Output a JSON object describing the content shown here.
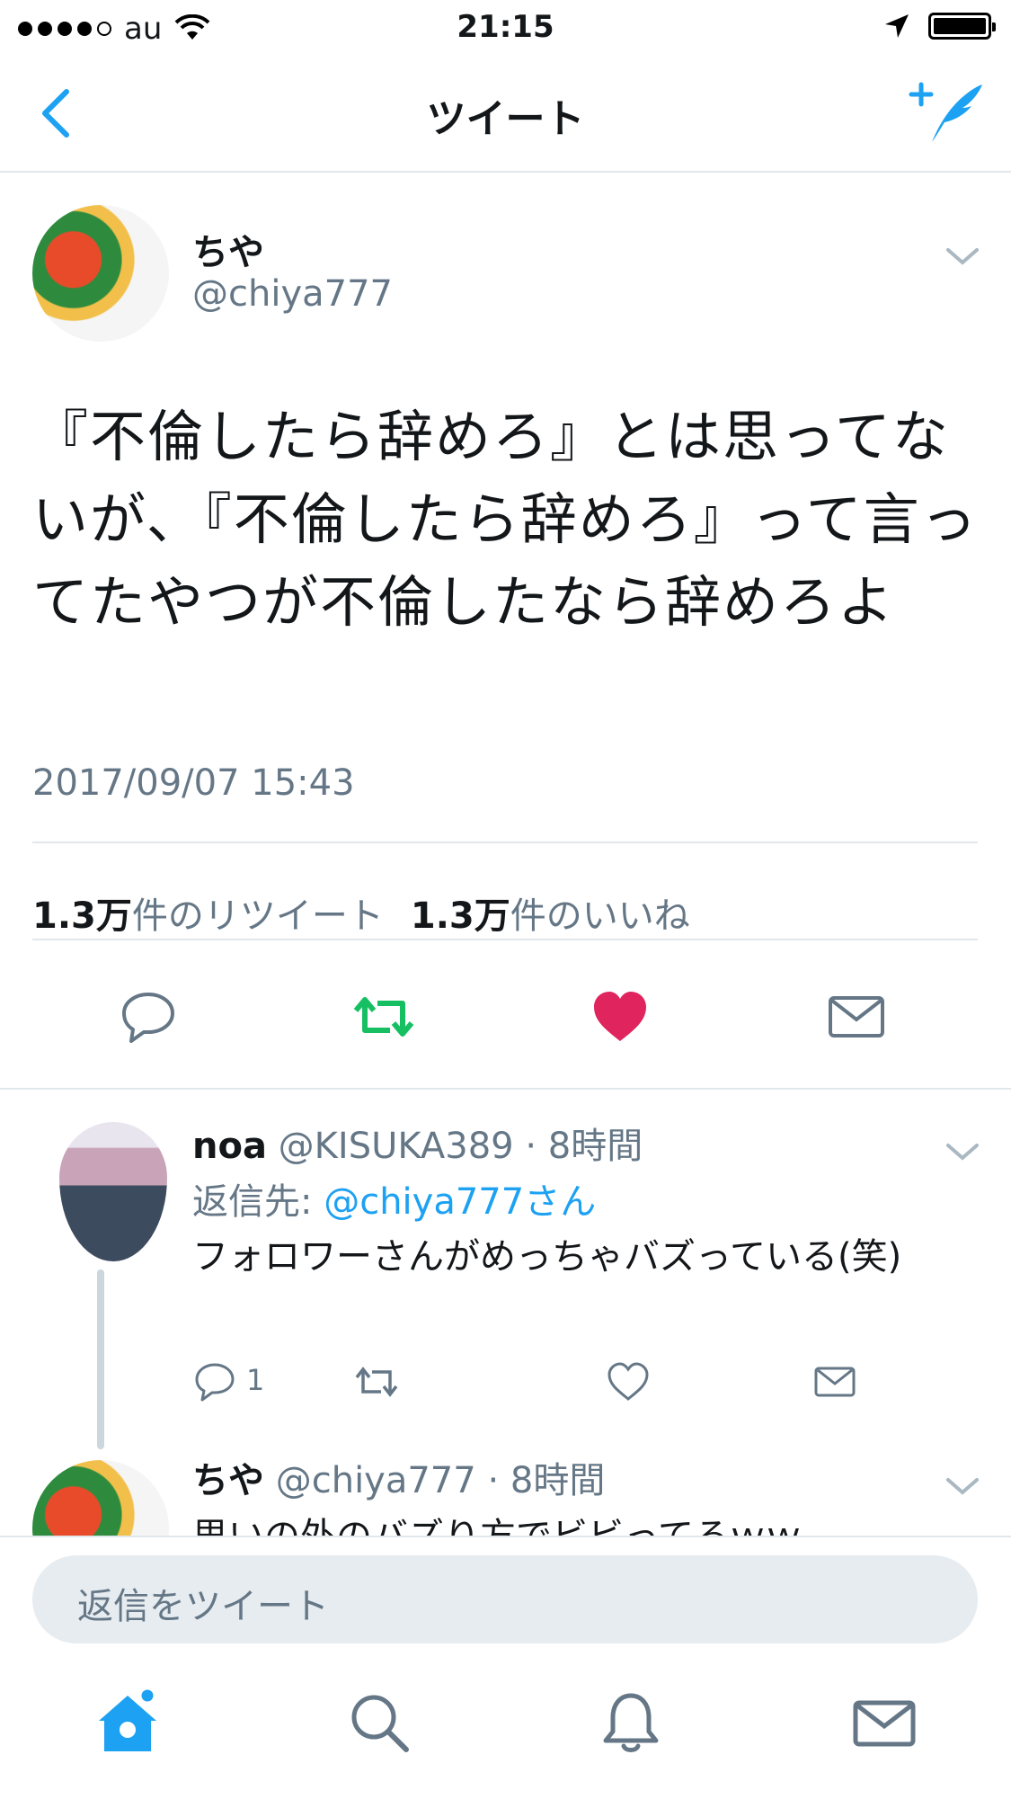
{
  "status_bar": {
    "carrier": "au",
    "time": "21:15"
  },
  "nav": {
    "title": "ツイート"
  },
  "tweet": {
    "name": "ちや",
    "handle": "@chiya777",
    "text": "『不倫したら辞めろ』とは思ってないが、『不倫したら辞めろ』って言ってたやつが不倫したなら辞めろよ",
    "timestamp": "2017/09/07 15:43",
    "retweet_count": "1.3万",
    "retweet_label": "件のリツイート",
    "like_count": "1.3万",
    "like_label": "件のいいね"
  },
  "replies": [
    {
      "name": "noa",
      "handle": "@KISUKA389",
      "time": "· 8時間",
      "reply_to_label": "返信先:",
      "reply_to_handle": "@chiya777さん",
      "text": "フォロワーさんがめっちゃバズっている(笑)",
      "reply_count": "1"
    },
    {
      "name": "ちや",
      "handle": "@chiya777",
      "time": "· 8時間",
      "text": "思いの外のバズり方でビビってるｗｗ"
    }
  ],
  "composer": {
    "placeholder": "返信をツイート"
  },
  "colors": {
    "accent": "#1da1f2",
    "retweet": "#17bf63",
    "like": "#e0245e",
    "muted": "#657786"
  },
  "icons": [
    "back-icon",
    "compose-icon",
    "reply-icon",
    "retweet-icon",
    "like-icon",
    "dm-icon",
    "home-icon",
    "search-icon",
    "notifications-icon",
    "messages-icon"
  ]
}
